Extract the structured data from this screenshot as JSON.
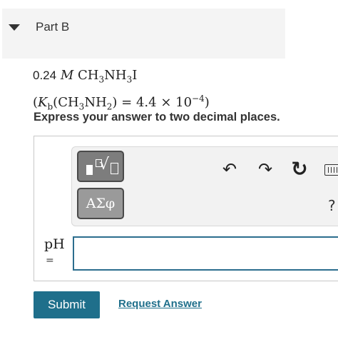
{
  "part": {
    "title": "Part B",
    "caret_icon": "caret-down-icon"
  },
  "problem": {
    "concentration": "0.24",
    "unit": "M",
    "compound_base": "CH",
    "compound_sub1": "3",
    "compound_mid": "NH",
    "compound_sub2": "3",
    "compound_end": "I",
    "kb_symbol": "K",
    "kb_sub": "b",
    "kb_species_pre": "(CH",
    "kb_species_sub1": "3",
    "kb_species_mid": "NH",
    "kb_species_sub2": "2",
    "kb_species_post": ")",
    "kb_value": "= 4.4 × 10",
    "kb_exp": "−4"
  },
  "instruction": "Express your answer to two decimal places.",
  "toolbar": {
    "templates_icon": "templates-icon",
    "symbols_label": "ΑΣφ",
    "undo_glyph": "↶",
    "redo_glyph": "↷",
    "reset_glyph": "↻",
    "help_glyph": "?"
  },
  "answer": {
    "label": "pH",
    "equals": "=",
    "value": ""
  },
  "actions": {
    "submit_label": "Submit",
    "request_label": "Request Answer"
  },
  "colors": {
    "accent": "#1f6f8b",
    "header_bg": "#f4f4f4",
    "toolbar_bg": "#f2f2f2"
  }
}
